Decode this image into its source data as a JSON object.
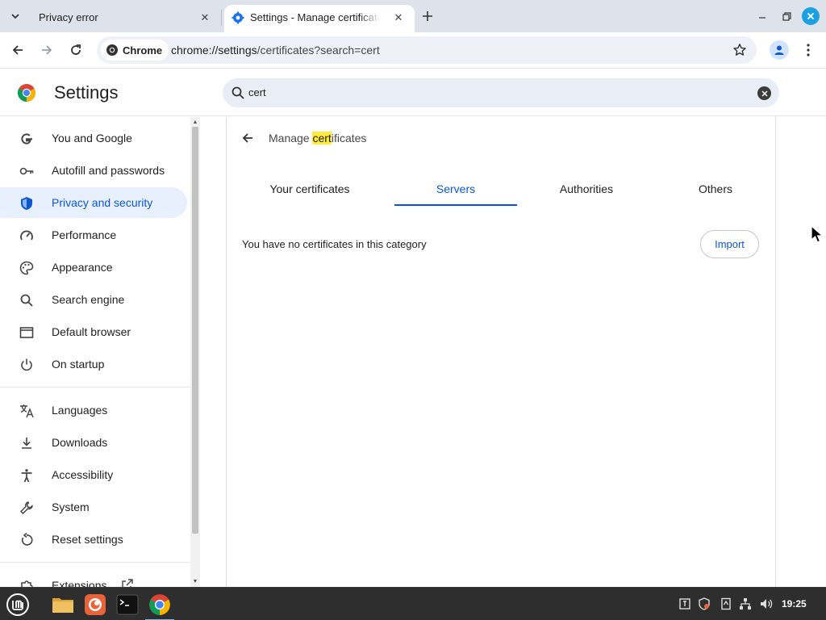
{
  "tabs": [
    {
      "title": "Privacy error",
      "active": false
    },
    {
      "title": "Settings - Manage certificates",
      "active": true
    }
  ],
  "toolbar": {
    "chip_label": "Chrome",
    "url_host": "chrome://settings",
    "url_path": "/certificates?search=cert"
  },
  "settings": {
    "title": "Settings",
    "search_value": "cert"
  },
  "sidebar": {
    "items": [
      {
        "label": "You and Google",
        "icon": "google-icon"
      },
      {
        "label": "Autofill and passwords",
        "icon": "key-icon"
      },
      {
        "label": "Privacy and security",
        "icon": "shield-icon",
        "selected": true
      },
      {
        "label": "Performance",
        "icon": "speedometer-icon"
      },
      {
        "label": "Appearance",
        "icon": "palette-icon"
      },
      {
        "label": "Search engine",
        "icon": "search-icon"
      },
      {
        "label": "Default browser",
        "icon": "browser-window-icon"
      },
      {
        "label": "On startup",
        "icon": "power-icon"
      },
      {
        "label": "Languages",
        "icon": "translate-icon"
      },
      {
        "label": "Downloads",
        "icon": "download-icon"
      },
      {
        "label": "Accessibility",
        "icon": "accessibility-icon"
      },
      {
        "label": "System",
        "icon": "wrench-icon"
      },
      {
        "label": "Reset settings",
        "icon": "reset-icon"
      },
      {
        "label": "Extensions",
        "icon": "puzzle-icon"
      }
    ]
  },
  "main": {
    "heading_prefix": "Manage ",
    "heading_highlight": "cert",
    "heading_suffix": "ificates",
    "tabs": [
      {
        "label": "Your certificates"
      },
      {
        "label": "Servers",
        "active": true
      },
      {
        "label": "Authorities"
      },
      {
        "label": "Others"
      }
    ],
    "empty_message": "You have no certificates in this category",
    "import_label": "Import"
  },
  "taskbar": {
    "clock": "19:25"
  },
  "colors": {
    "accent": "#0b57d0",
    "selected_bg": "#e8f0fe",
    "highlight": "#ffeb3b",
    "tabstrip_bg": "#dee3eb",
    "taskbar_bg": "#2e2e2e"
  }
}
